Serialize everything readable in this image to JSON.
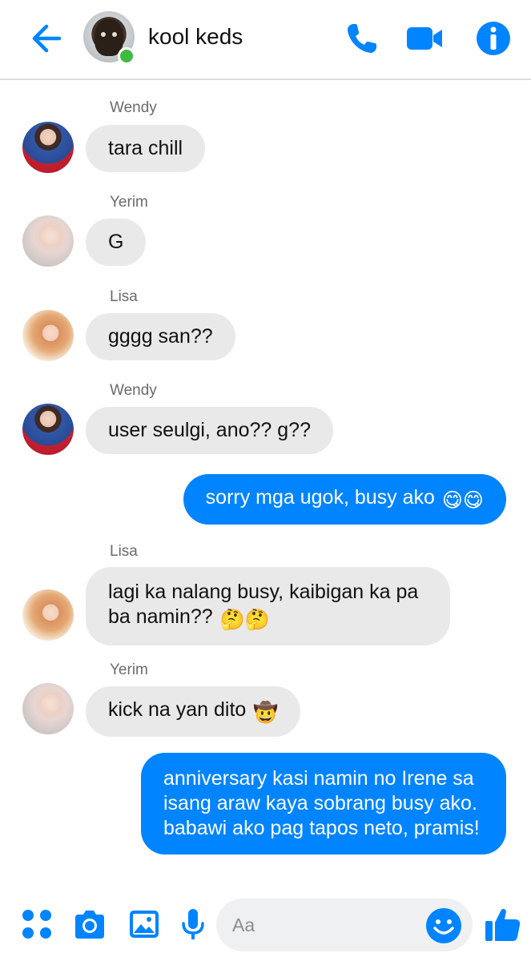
{
  "header": {
    "title": "kool keds",
    "back_icon": "arrow-left-icon",
    "phone_icon": "phone-icon",
    "video_icon": "video-camera-icon",
    "info_icon": "info-icon",
    "online": true
  },
  "messages": [
    {
      "sender": "Wendy",
      "text": "tara chill",
      "direction": "incoming"
    },
    {
      "sender": "Yerim",
      "text": "G",
      "direction": "incoming"
    },
    {
      "sender": "Lisa",
      "text": "gggg san??",
      "direction": "incoming"
    },
    {
      "sender": "Wendy",
      "text": "user seulgi, ano?? g??",
      "direction": "incoming"
    },
    {
      "sender": "",
      "text": "sorry mga ugok, busy ako",
      "emoji": "😋😋",
      "direction": "outgoing"
    },
    {
      "sender": "Lisa",
      "text": "lagi ka nalang busy, kaibigan ka pa ba namin??",
      "emoji": "🤔🤔",
      "direction": "incoming"
    },
    {
      "sender": "Yerim",
      "text": "kick na yan dito",
      "emoji": "🤠",
      "direction": "incoming"
    },
    {
      "sender": "",
      "text": "anniversary kasi namin no Irene sa isang araw kaya sobrang busy ako. babawi ako pag tapos neto, pramis!",
      "direction": "outgoing"
    }
  ],
  "composer": {
    "placeholder": "Aa",
    "value": "",
    "icons": [
      "apps-icon",
      "camera-icon",
      "image-icon",
      "microphone-icon",
      "emoji-icon",
      "thumbs-up-icon"
    ]
  },
  "colors": {
    "accent": "#0084ff",
    "incoming_bubble": "#e9e9e9",
    "online_dot": "#3fbb3f"
  }
}
